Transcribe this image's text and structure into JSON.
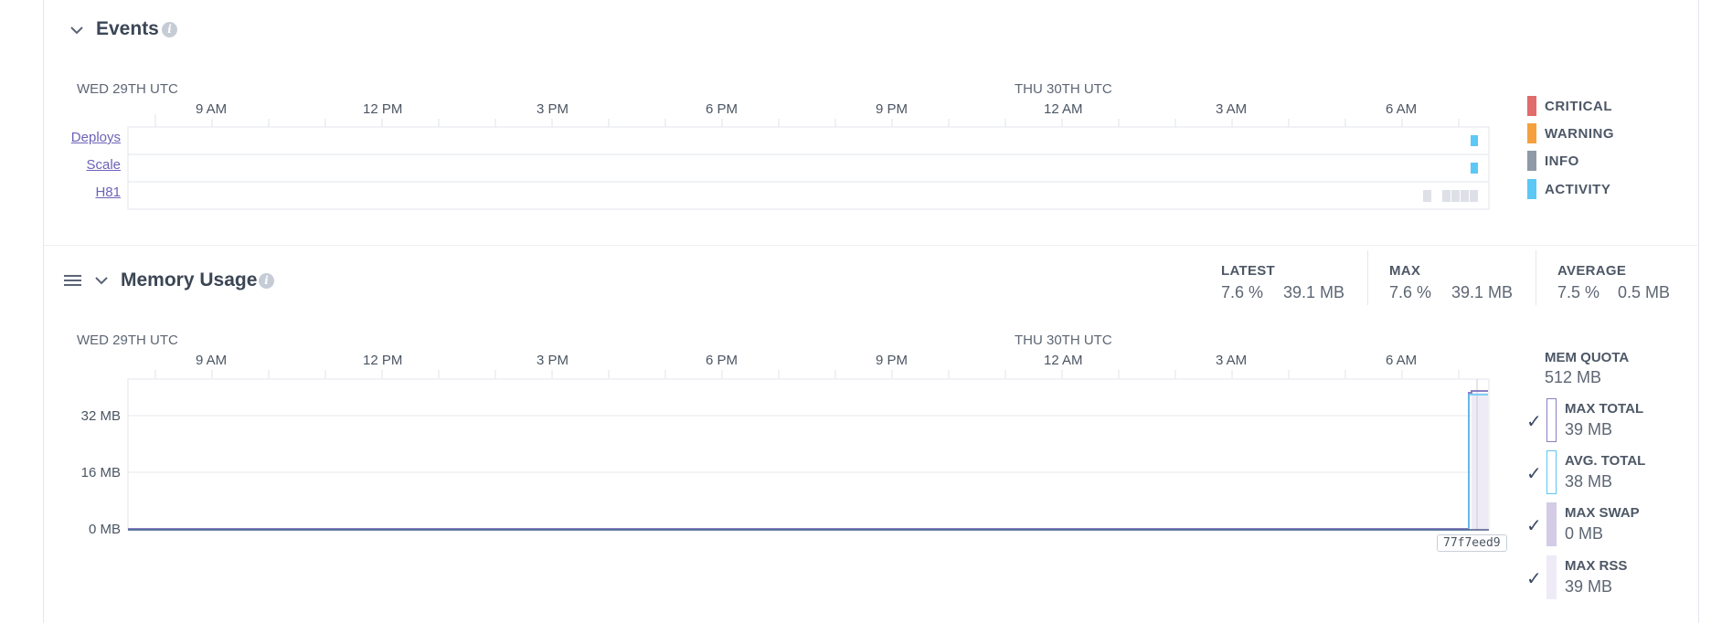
{
  "events": {
    "title": "Events",
    "date_left": "WED 29TH UTC",
    "date_mid": "THU 30TH UTC",
    "ticks": [
      "9 AM",
      "12 PM",
      "3 PM",
      "6 PM",
      "9 PM",
      "12 AM",
      "3 AM",
      "6 AM"
    ],
    "rows": [
      "Deploys",
      "Scale",
      "H81"
    ],
    "legend": [
      {
        "label": "CRITICAL",
        "color": "#e06c6c"
      },
      {
        "label": "WARNING",
        "color": "#f5a03c"
      },
      {
        "label": "INFO",
        "color": "#8f99a8"
      },
      {
        "label": "ACTIVITY",
        "color": "#5bc8f5"
      }
    ]
  },
  "memory": {
    "title": "Memory Usage",
    "stats": [
      {
        "label": "LATEST",
        "pct": "7.6 %",
        "mb": "39.1 MB"
      },
      {
        "label": "MAX",
        "pct": "7.6 %",
        "mb": "39.1 MB"
      },
      {
        "label": "AVERAGE",
        "pct": "7.5 %",
        "mb": "0.5 MB"
      }
    ],
    "date_left": "WED 29TH UTC",
    "date_mid": "THU 30TH UTC",
    "ticks": [
      "9 AM",
      "12 PM",
      "3 PM",
      "6 PM",
      "9 PM",
      "12 AM",
      "3 AM",
      "6 AM"
    ],
    "y_labels": [
      "32 MB",
      "16 MB",
      "0 MB"
    ],
    "commit": "77f7eed9",
    "quota": {
      "label": "MEM QUOTA",
      "value": "512 MB"
    },
    "legend": [
      {
        "label": "MAX TOTAL",
        "value": "39 MB",
        "checked": "✓"
      },
      {
        "label": "AVG. TOTAL",
        "value": "38 MB",
        "checked": "✓"
      },
      {
        "label": "MAX SWAP",
        "value": "0 MB",
        "checked": "✓"
      },
      {
        "label": "MAX RSS",
        "value": "39 MB",
        "checked": "✓"
      }
    ],
    "colors": {
      "max_total": "#8b7fc2",
      "avg_total": "#5bc8f5",
      "max_swap": "#d4cbe6",
      "max_rss": "#eeeaf6"
    }
  }
}
